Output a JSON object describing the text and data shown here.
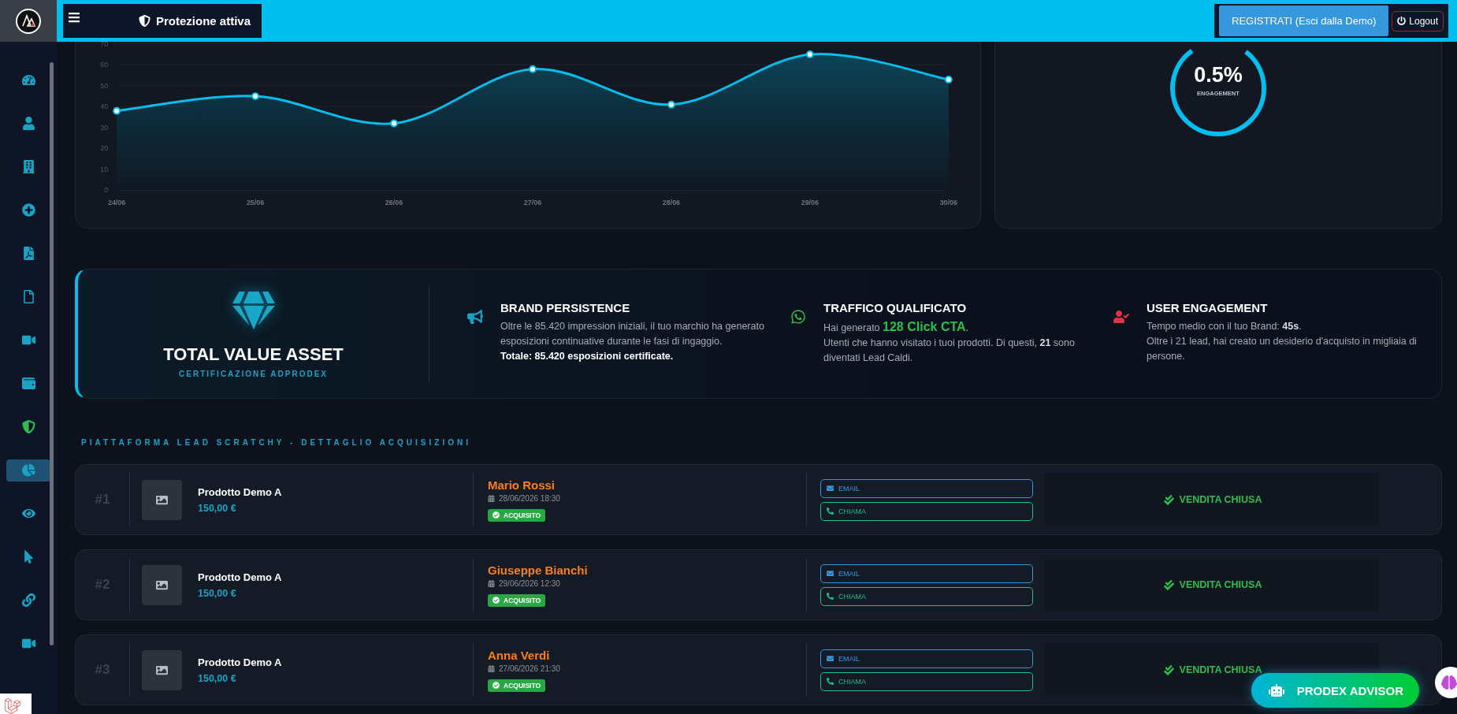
{
  "header": {
    "status": "Protezione attiva",
    "register_button": "REGISTRATI (Esci dalla Demo)",
    "logout_button": "Logout"
  },
  "sidebar": {
    "items": [
      {
        "selected": false
      },
      {
        "selected": false
      },
      {
        "selected": false
      },
      {
        "selected": false
      },
      {
        "selected": false
      },
      {
        "selected": false
      },
      {
        "selected": false
      },
      {
        "selected": false
      },
      {
        "selected": false
      },
      {
        "selected": true
      },
      {
        "selected": false
      },
      {
        "selected": false
      },
      {
        "selected": false
      },
      {
        "selected": false
      }
    ]
  },
  "trend_chart": {
    "chart_data": {
      "type": "area",
      "categories": [
        "24/06",
        "25/06",
        "26/06",
        "27/06",
        "28/06",
        "29/06",
        "30/06"
      ],
      "series": [
        {
          "color": "#00bfef",
          "values": [
            38,
            45,
            32,
            58,
            41,
            65,
            53
          ]
        }
      ],
      "ylim": [
        0,
        70
      ],
      "yticks": [
        0,
        10,
        20,
        30,
        40,
        50,
        60,
        70
      ],
      "grid": true
    }
  },
  "engagement": {
    "value": "0.5%",
    "label": "ENGAGEMENT"
  },
  "asset": {
    "title": "TOTAL VALUE ASSET",
    "subtitle": "CERTIFICAZIONE ADPRODEX",
    "stats": [
      {
        "title": "BRAND PERSISTENCE",
        "lines": [
          {
            "text": "Oltre le 85.420 impression iniziali, il tuo marchio ha generato esposizioni continuative durante le fasi di ingaggio.",
            "kind": "plain"
          },
          {
            "text": "Totale: 85.420 esposizioni certificate.",
            "kind": "strong"
          }
        ]
      },
      {
        "title": "TRAFFICO QUALIFICATO",
        "lines": [
          {
            "text": "Hai generato **128 Click CTA**.",
            "kind": "accent"
          },
          {
            "text": "Utenti che hanno visitato i tuoi prodotti. Di questi, **21** sono diventati Lead Caldi.",
            "kind": "plain"
          }
        ]
      },
      {
        "title": "USER ENGAGEMENT",
        "lines": [
          {
            "text": "Tempo medio con il tuo Brand: **45s**.",
            "kind": "plain"
          },
          {
            "text": "Oltre i 21 lead, hai creato un desiderio d'acquisto in migliaia di persone.",
            "kind": "plain"
          }
        ]
      }
    ]
  },
  "leads": {
    "title": "PIATTAFORMA LEAD SCRATCHY - DETTAGLIO ACQUISIZIONI",
    "rows": [
      {
        "rank": "#1",
        "product": "Prodotto Demo A",
        "price": "150,00 €",
        "customer": "Mario Rossi",
        "date": "28/06/2026 18:30",
        "status": "ACQUISITO",
        "email": "EMAIL",
        "call": "CHIAMA",
        "outcome": "VENDITA CHIUSA"
      },
      {
        "rank": "#2",
        "product": "Prodotto Demo A",
        "price": "150,00 €",
        "customer": "Giuseppe Bianchi",
        "date": "29/06/2026 12:30",
        "status": "ACQUISITO",
        "email": "EMAIL",
        "call": "CHIAMA",
        "outcome": "VENDITA CHIUSA"
      },
      {
        "rank": "#3",
        "product": "Prodotto Demo A",
        "price": "150,00 €",
        "customer": "Anna Verdi",
        "date": "27/06/2026 21:30",
        "status": "ACQUISITO",
        "email": "EMAIL",
        "call": "CHIAMA",
        "outcome": "VENDITA CHIUSA"
      }
    ]
  },
  "advisor_button": "PRODEX ADVISOR"
}
